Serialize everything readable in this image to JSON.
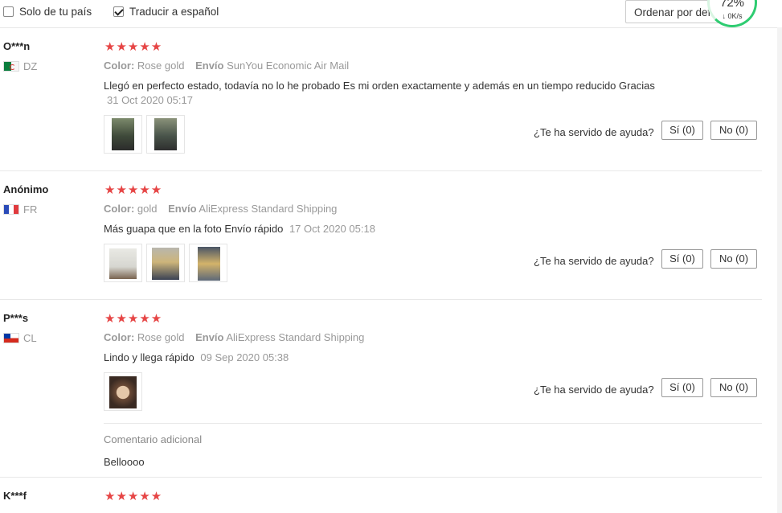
{
  "toolbar": {
    "only_country_label": "Solo de tu país",
    "translate_label": "Traducir a español",
    "sort_label": "Ordenar por defecto"
  },
  "speed_widget": {
    "percent": "72%",
    "rate": "↓ 0K/s"
  },
  "helpful_label": "¿Te ha servido de ayuda?",
  "reviews": [
    {
      "name": "O***n",
      "country": "DZ",
      "stars": "★★★★★",
      "color_label": "Color:",
      "color": "Rose gold",
      "ship_label": "Envío",
      "shipping": "SunYou Economic Air Mail",
      "text": "Llegó en perfecto estado, todavía no lo he probado Es mi orden exactamente y además en un tiempo reducido Gracias",
      "date": "31 Oct 2020 05:17",
      "yes": "Sí (0)",
      "no": "No (0)"
    },
    {
      "name": "Anónimo",
      "country": "FR",
      "stars": "★★★★★",
      "color_label": "Color:",
      "color": "gold",
      "ship_label": "Envío",
      "shipping": "AliExpress Standard Shipping",
      "text": "Más guapa que en la foto Envío rápido",
      "date": "17 Oct 2020 05:18",
      "yes": "Sí (0)",
      "no": "No (0)"
    },
    {
      "name": "P***s",
      "country": "CL",
      "stars": "★★★★★",
      "color_label": "Color:",
      "color": "Rose gold",
      "ship_label": "Envío",
      "shipping": "AliExpress Standard Shipping",
      "text": "Lindo y llega rápido",
      "date": "09 Sep 2020 05:38",
      "yes": "Sí (0)",
      "no": "No (0)",
      "additional_title": "Comentario adicional",
      "additional_text": "Belloooo"
    },
    {
      "name": "K***f",
      "stars": "★★★★★"
    }
  ]
}
